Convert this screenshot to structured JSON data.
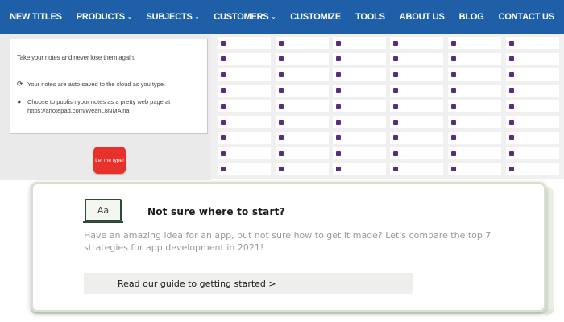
{
  "nav": {
    "items": [
      {
        "label": "NEW TITLES",
        "caret": false
      },
      {
        "label": "PRODUCTS",
        "caret": true
      },
      {
        "label": "SUBJECTS",
        "caret": true
      },
      {
        "label": "CUSTOMERS",
        "caret": true
      },
      {
        "label": "CUSTOMIZE",
        "caret": false
      },
      {
        "label": "TOOLS",
        "caret": false
      },
      {
        "label": "ABOUT US",
        "caret": false
      },
      {
        "label": "BLOG",
        "caret": false
      },
      {
        "label": "CONTACT US",
        "caret": false
      }
    ],
    "caret_glyph": "⌄"
  },
  "note": {
    "heading": "Take your notes and never lose them again.",
    "row1": "Your notes are auto-saved to the cloud as you type.",
    "row2": "Choose to publish your notes as a pretty web page at https://anotepad.com/WeanL8NMAjna",
    "row1_icon": "refresh-icon",
    "row2_icon": "globe-icon",
    "button": "Let me type!"
  },
  "guide": {
    "title": "Not sure where to start?",
    "description": "Have an amazing idea for an app, but not sure how to get it made? Let's compare the top 7 strategies for app development in 2021!",
    "button": "Read our guide to getting started >",
    "icon_text": "Aa"
  },
  "colors": {
    "nav_bg": "#1f5fa8",
    "tile_icon": "#5b2a86",
    "button_red": "#e8312a",
    "guide_border": "#d6dfd0"
  }
}
